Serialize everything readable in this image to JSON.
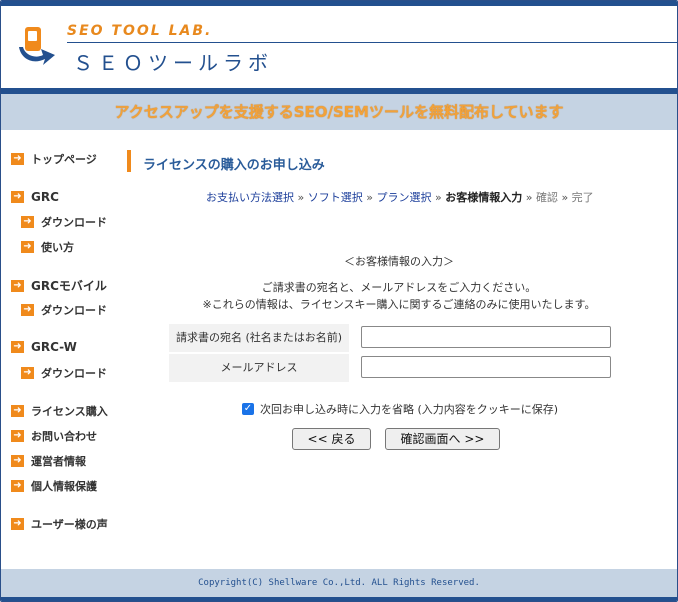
{
  "header": {
    "logo_en": "SEO TOOL LAB.",
    "logo_jp": "ＳＥＯツールラボ",
    "banner": "アクセスアップを支援するSEO/SEMツールを無料配布しています"
  },
  "sidebar": {
    "items": [
      {
        "label": "トップページ"
      },
      {
        "label": "GRC"
      },
      {
        "label": "ダウンロード"
      },
      {
        "label": "使い方"
      },
      {
        "label": "GRCモバイル"
      },
      {
        "label": "ダウンロード"
      },
      {
        "label": "GRC-W"
      },
      {
        "label": "ダウンロード"
      },
      {
        "label": "ライセンス購入"
      },
      {
        "label": "お問い合わせ"
      },
      {
        "label": "運営者情報"
      },
      {
        "label": "個人情報保護"
      },
      {
        "label": "ユーザー様の声"
      }
    ]
  },
  "main": {
    "title": "ライセンスの購入のお申し込み",
    "breadcrumb": {
      "step1": "お支払い方法選択",
      "step2": "ソフト選択",
      "step3": "プラン選択",
      "step4": "お客様情報入力",
      "step5": "確認",
      "step6": "完了",
      "sep": "»"
    },
    "section_heading": "＜お客様情報の入力＞",
    "instruction1": "ご請求書の宛名と、メールアドレスをご入力ください。",
    "instruction2": "※これらの情報は、ライセンスキー購入に関するご連絡のみに使用いたします。",
    "form": {
      "name_label": "請求書の宛名 (社名またはお名前)",
      "name_value": "",
      "email_label": "メールアドレス",
      "email_value": ""
    },
    "remember_label": "次回お申し込み時に入力を省略 (入力内容をクッキーに保存)",
    "remember_checked": true,
    "back_button": "<< 戻る",
    "confirm_button": "確認画面へ >>"
  },
  "footer": {
    "copyright": "Copyright(C) Shellware Co.,Ltd. ALL Rights Reserved."
  },
  "colors": {
    "brand_blue": "#23508f",
    "accent_orange": "#f08a1c",
    "band_light_blue": "#c5d3e3"
  }
}
